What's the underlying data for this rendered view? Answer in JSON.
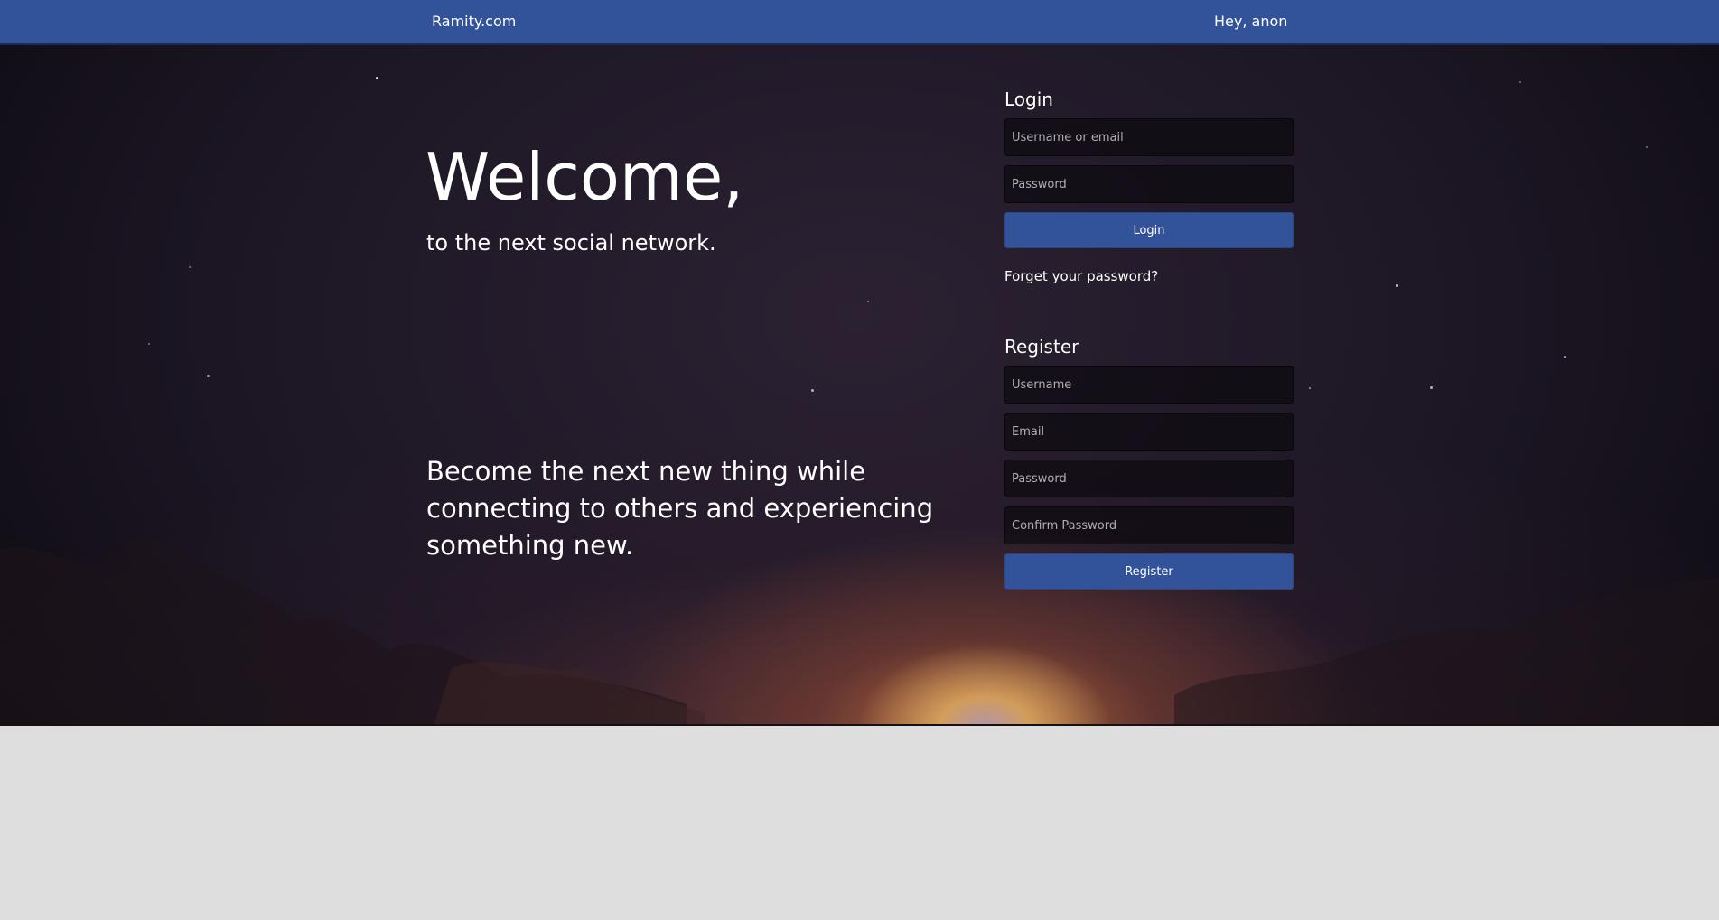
{
  "header": {
    "brand": "Ramity.com",
    "greeting": "Hey, anon"
  },
  "hero": {
    "title": "Welcome,",
    "subtitle": "to the next social network.",
    "tagline": "Become the next new thing while connecting to others and experiencing something new."
  },
  "login": {
    "heading": "Login",
    "username_placeholder": "Username or email",
    "password_placeholder": "Password",
    "submit_label": "Login",
    "forgot_label": "Forget your password?"
  },
  "register": {
    "heading": "Register",
    "username_placeholder": "Username",
    "email_placeholder": "Email",
    "password_placeholder": "Password",
    "confirm_placeholder": "Confirm Password",
    "submit_label": "Register"
  },
  "colors": {
    "accent": "#32529a",
    "footer_background": "#dedede"
  }
}
